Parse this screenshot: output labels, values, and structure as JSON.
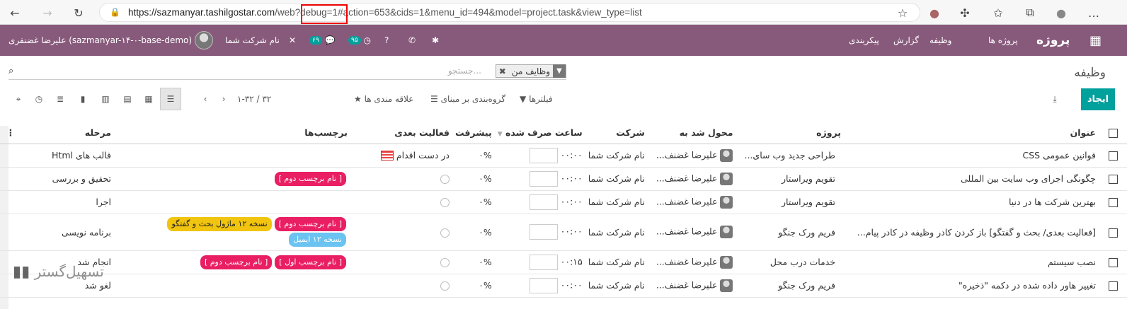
{
  "browser": {
    "url_domain": "https://sazmanyar.tashilgostar.com",
    "url_path": "/web?debug=1#action=653&cids=1&menu_id=494&model=project.task&view_type=list"
  },
  "navbar": {
    "app_name": "پروژه",
    "menus": [
      "پروژه ها",
      "وظیفه",
      "گزارش",
      "پیکربندی"
    ],
    "company": "نام شرکت شما",
    "user": "علیرضا غضنفری (sazmanyar-۱۴-۰-base-demo)",
    "badge_activity": "۹۵",
    "badge_messages": "۶۹"
  },
  "control_panel": {
    "title": "وظیفه",
    "facet_label": "وظایف من",
    "search_placeholder": "جستجو...",
    "create_label": "ایجاد",
    "filters_label": "فیلترها",
    "groupby_label": "گروه‌بندی بر مبنای",
    "favorites_label": "علاقه مندی ها",
    "pager": "۱-۳۲ / ۳۲"
  },
  "columns": [
    "عنوان",
    "پروژه",
    "محول شد به",
    "شرکت",
    "ساعت صرف شده",
    "پیشرفت",
    "فعالیت بعدی",
    "برچسب‌ها",
    "مرحله"
  ],
  "rows": [
    {
      "title": "قوانین عمومی CSS",
      "project": "طراحی جدید وب سای...",
      "assignee": "علیرضا غضنف...",
      "company": "نام شرکت شما",
      "hours": "۰۰:۰۰",
      "progress": "۰%",
      "activity": "در دست اقدام",
      "tags": [],
      "stage": "قالب های Html"
    },
    {
      "title": "چگونگی اجرای وب سایت بین المللی",
      "project": "تقویم ویراستار",
      "assignee": "علیرضا غضنف...",
      "company": "نام شرکت شما",
      "hours": "۰۰:۰۰",
      "progress": "۰%",
      "activity": "",
      "tags": [
        {
          "label": "[ نام برچسب دوم ]",
          "color": "pink"
        }
      ],
      "stage": "تحقیق و بررسی"
    },
    {
      "title": "بهترین شرکت ها در دنیا",
      "project": "تقویم ویراستار",
      "assignee": "علیرضا غضنف...",
      "company": "نام شرکت شما",
      "hours": "۰۰:۰۰",
      "progress": "۰%",
      "activity": "",
      "tags": [],
      "stage": "اجرا"
    },
    {
      "title": "[فعالیت بعدی/ بحث و گفتگو] باز کردن کادر وظیفه در کادر پیام...",
      "project": "فریم ورک جنگو",
      "assignee": "علیرضا غضنف...",
      "company": "نام شرکت شما",
      "hours": "۰۰:۰۰",
      "progress": "۰%",
      "activity": "",
      "tags": [
        {
          "label": "[ نام برچسب دوم ]",
          "color": "pink"
        },
        {
          "label": "نسخه ۱۲ ماژول بحث و گفتگو",
          "color": "yellow"
        },
        {
          "label": "نسخه ۱۲ ایمیل",
          "color": "blue"
        }
      ],
      "stage": "برنامه نویسی"
    },
    {
      "title": "نصب سیستم",
      "project": "خدمات درب محل",
      "assignee": "علیرضا غضنف...",
      "company": "نام شرکت شما",
      "hours": "۰۰:۱۵",
      "progress": "۰%",
      "activity": "",
      "tags": [
        {
          "label": "[ نام برچسب اول ]",
          "color": "pink"
        },
        {
          "label": "[ نام برچسب دوم ]",
          "color": "pink"
        }
      ],
      "stage": "انجام شد"
    },
    {
      "title": "تغییر هاور داده شده در دکمه \"ذخیره\"",
      "project": "فریم ورک جنگو",
      "assignee": "علیرضا غضنف...",
      "company": "نام شرکت شما",
      "hours": "۰۰:۰۰",
      "progress": "۰%",
      "activity": "",
      "tags": [],
      "stage": "لغو شد"
    }
  ],
  "watermark": "تسهیل‌گستر"
}
